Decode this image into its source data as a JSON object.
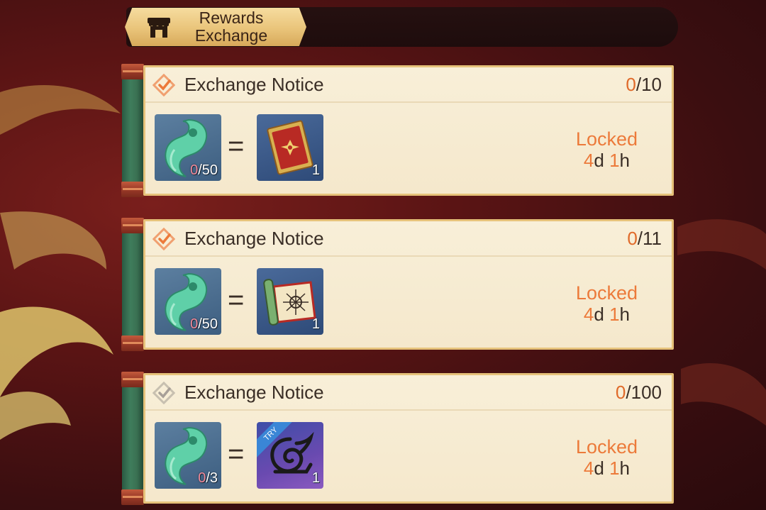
{
  "header": {
    "title_line1": "Rewards",
    "title_line2": "Exchange",
    "icon": "shop-icon"
  },
  "cards": [
    {
      "title": "Exchange Notice",
      "count_current": "0",
      "count_total": "/10",
      "cost_have": "0",
      "cost_need": "/50",
      "reward_icon": "red-card-icon",
      "reward_qty": "1",
      "status": "Locked",
      "time_days": "4",
      "time_d_unit": "d ",
      "time_hours": "1",
      "time_h_unit": "h",
      "checkmark_active": true
    },
    {
      "title": "Exchange Notice",
      "count_current": "0",
      "count_total": "/11",
      "cost_have": "0",
      "cost_need": "/50",
      "reward_icon": "scroll-icon",
      "reward_qty": "1",
      "status": "Locked",
      "time_days": "4",
      "time_d_unit": "d ",
      "time_hours": "1",
      "time_h_unit": "h",
      "checkmark_active": true
    },
    {
      "title": "Exchange Notice",
      "count_current": "0",
      "count_total": "/100",
      "cost_have": "0",
      "cost_need": "/3",
      "reward_icon": "leaf-village-symbol-icon",
      "reward_badge": "TRY",
      "reward_qty": "1",
      "status": "Locked",
      "time_days": "4",
      "time_d_unit": "d ",
      "time_hours": "1",
      "time_h_unit": "h",
      "checkmark_active": false
    }
  ],
  "colors": {
    "accent_orange": "#ec7a3a",
    "panel_bg": "#f8efd8",
    "spine_green": "#3f7d5c",
    "text_dark": "#3a2e26"
  }
}
